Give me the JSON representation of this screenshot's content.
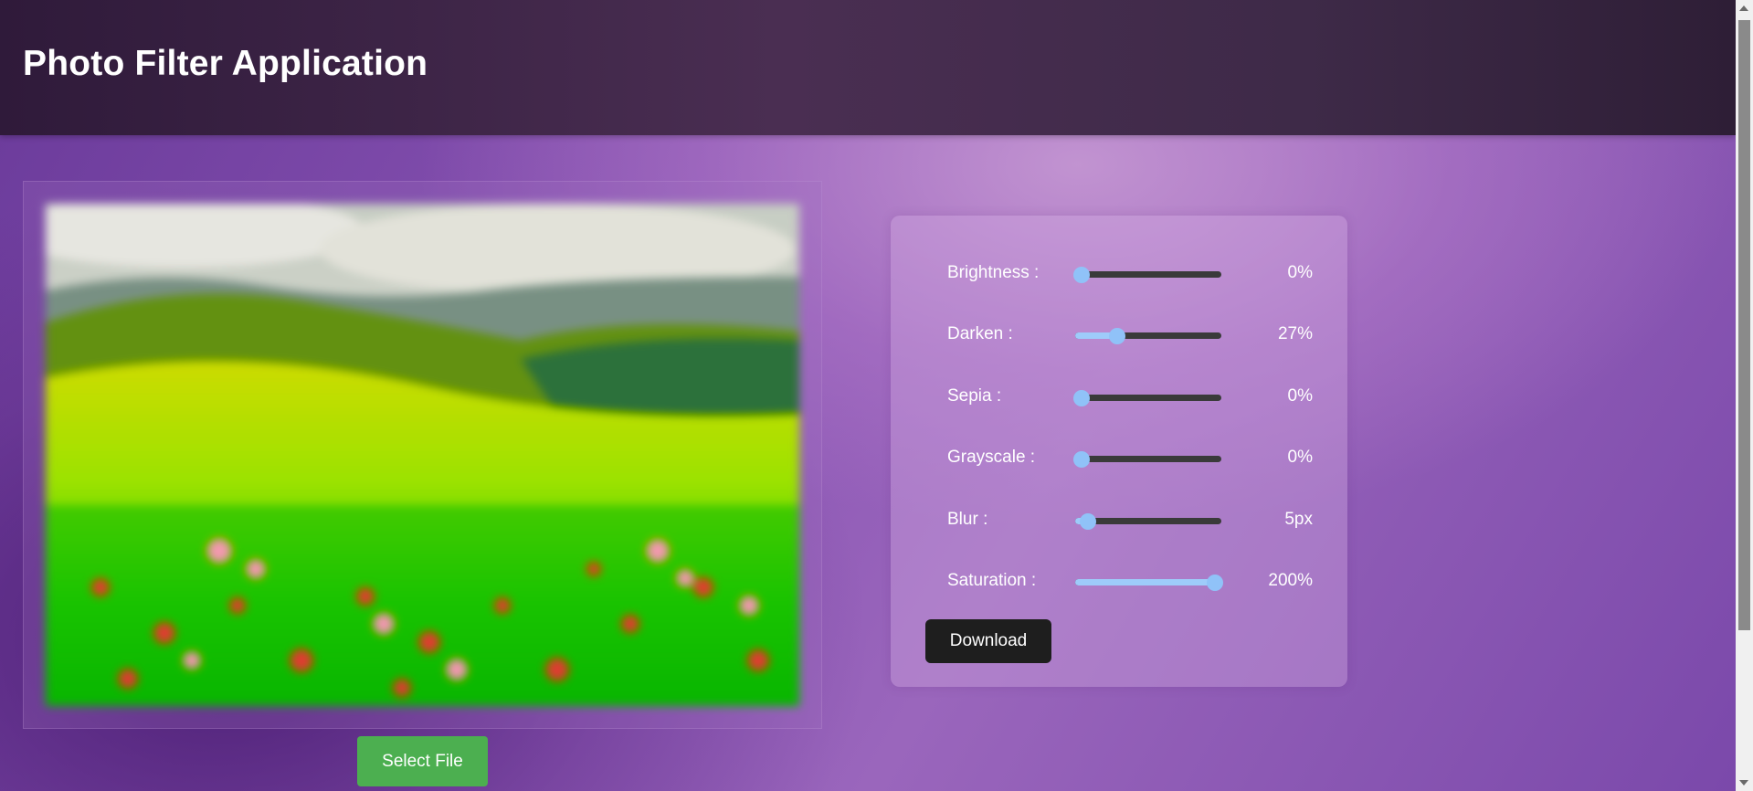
{
  "app": {
    "title": "Photo Filter Application"
  },
  "actions": {
    "select_file": "Select File",
    "download": "Download"
  },
  "filters": [
    {
      "label": "Brightness :",
      "value": "0%",
      "level": 0.0
    },
    {
      "label": "Darken :",
      "value": "27%",
      "level": 0.27
    },
    {
      "label": "Sepia :",
      "value": "0%",
      "level": 0.0
    },
    {
      "label": "Grayscale :",
      "value": "0%",
      "level": 0.0
    },
    {
      "label": "Blur :",
      "value": "5px",
      "level": 0.05
    },
    {
      "label": "Saturation :",
      "value": "200%",
      "level": 1.0
    }
  ],
  "colors": {
    "accent_green": "#4caf50",
    "slider_fill": "#9ecbfa",
    "slider_track": "#3a3a3a",
    "download_bg": "#1e1e1e"
  },
  "icons": {
    "scroll_up": "chevron-up-icon",
    "scroll_down": "chevron-down-icon"
  }
}
